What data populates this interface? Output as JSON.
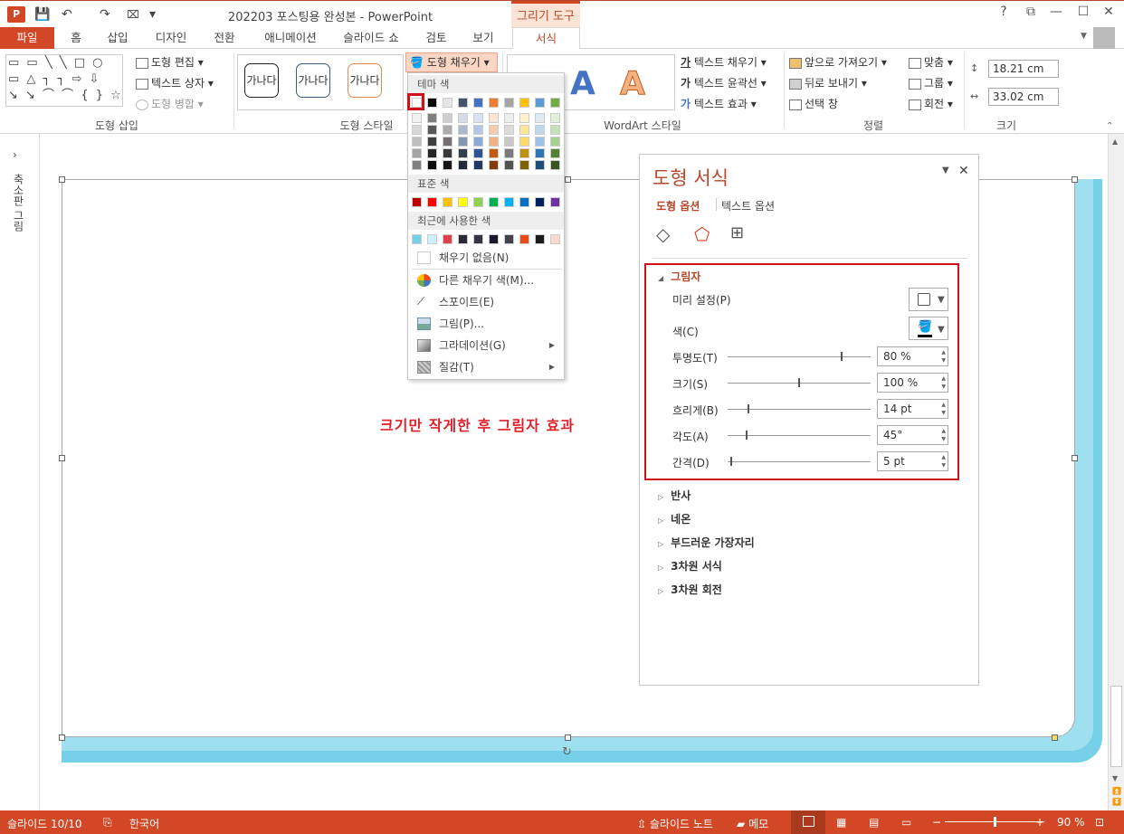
{
  "app": {
    "badge": "P",
    "title": "202203 포스팅용 완성본 - PowerPoint",
    "context_tab": "그리기 도구"
  },
  "qat": {
    "save": "💾",
    "undo": "↶",
    "redo": "↷",
    "more": "▾"
  },
  "window": {
    "help": "?",
    "restore_ribbon": "⧉",
    "minimize": "—",
    "maximize": "☐",
    "close": "✕"
  },
  "tabs": [
    "파일",
    "홈",
    "삽입",
    "디자인",
    "전환",
    "애니메이션",
    "슬라이드 쇼",
    "검토",
    "보기",
    "서식"
  ],
  "ribbon": {
    "shapes_gallery": "▭ ▭ ╲ ╲ □ ○\n▭ △ ┐ ┐ ⇨ ⇩\n↘ ↘ ⌒ ⌒ { } ☆",
    "edit_shape": "도형 편집",
    "text_box": "텍스트 상자",
    "merge_shapes": "도형 병합",
    "group_insert_shapes": "도형 삽입",
    "style_sample": "가나다",
    "fill_button": "도형 채우기",
    "group_shape_styles": "도형 스타일",
    "wordart_letter": "A",
    "text_fill": "텍스트 채우기",
    "text_outline": "텍스트 윤곽선",
    "text_effects": "텍스트 효과",
    "group_wordart": "WordArt 스타일",
    "bring_forward": "앞으로 가져오기",
    "send_backward": "뒤로 보내기",
    "selection_pane": "선택 창",
    "align": "맞춤",
    "group": "그룹",
    "rotate": "회전",
    "group_arrange": "정렬",
    "height": "18.21 cm",
    "width": "33.02 cm",
    "group_size": "크기"
  },
  "thumbnails_label": "축소판 그림",
  "slide": {
    "text": "크기만 작게한 후 그림자 효과"
  },
  "fill_dropdown": {
    "theme_colors_header": "테마 색",
    "standard_colors_header": "표준 색",
    "recent_colors_header": "최근에 사용한 색",
    "theme_top": [
      "#ffffff",
      "#000000",
      "#e7e6e6",
      "#44546a",
      "#4472c4",
      "#ed7d31",
      "#a5a5a5",
      "#ffc000",
      "#5b9bd5",
      "#70ad47"
    ],
    "theme_shades": [
      [
        "#f2f2f2",
        "#7f7f7f",
        "#d0cece",
        "#d6dce4",
        "#d9e2f3",
        "#fbe5d5",
        "#ededed",
        "#fff2cc",
        "#deebf6",
        "#e2efd9"
      ],
      [
        "#d8d8d8",
        "#595959",
        "#aeabab",
        "#adb9ca",
        "#b4c6e7",
        "#f7cbac",
        "#dbdbdb",
        "#fee599",
        "#bdd7ee",
        "#c5e0b3"
      ],
      [
        "#bfbfbf",
        "#3f3f3f",
        "#757070",
        "#8496b0",
        "#8eaadb",
        "#f4b183",
        "#c9c9c9",
        "#ffd965",
        "#9cc3e5",
        "#a8d08d"
      ],
      [
        "#a5a5a5",
        "#262626",
        "#3a3838",
        "#323f4f",
        "#2f5496",
        "#c55a11",
        "#7b7b7b",
        "#bf9000",
        "#2e75b5",
        "#538135"
      ],
      [
        "#7f7f7f",
        "#0c0c0c",
        "#171616",
        "#222a35",
        "#1f3864",
        "#833c0b",
        "#525252",
        "#7f6000",
        "#1e4e79",
        "#375623"
      ]
    ],
    "standard": [
      "#c00000",
      "#ff0000",
      "#ffc000",
      "#ffff00",
      "#92d050",
      "#00b050",
      "#00b0f0",
      "#0070c0",
      "#002060",
      "#7030a0"
    ],
    "recent": [
      "#75d0e8",
      "#cdeefa",
      "#e0404a",
      "#2a2a3a",
      "#333344",
      "#1a1a2a",
      "#404050",
      "#e84a1a",
      "#1c1c1c",
      "#f8d8d0"
    ],
    "no_fill": "채우기 없음(N)",
    "more_colors": "다른 채우기 색(M)...",
    "eyedropper": "스포이트(E)",
    "picture": "그림(P)...",
    "gradient": "그라데이션(G)",
    "texture": "질감(T)"
  },
  "format_pane": {
    "title": "도형 서식",
    "tab_shape": "도형 옵션",
    "tab_text": "텍스트 옵션",
    "shadow_section": "그림자",
    "preset_label": "미리 설정(P)",
    "color_label": "색(C)",
    "rows": [
      {
        "label": "투명도(T)",
        "value": "80 %",
        "level": 0.8
      },
      {
        "label": "크기(S)",
        "value": "100 %",
        "level": 0.5
      },
      {
        "label": "흐리게(B)",
        "value": "14 pt",
        "level": 0.14
      },
      {
        "label": "각도(A)",
        "value": "45°",
        "level": 0.125
      },
      {
        "label": "간격(D)",
        "value": "5 pt",
        "level": 0.02
      }
    ],
    "sections": [
      "반사",
      "네온",
      "부드러운 가장자리",
      "3차원 서식",
      "3차원 회전"
    ]
  },
  "status": {
    "slide_info": "슬라이드 10/10",
    "language": "한국어",
    "notes": "슬라이드 노트",
    "comments": "메모",
    "zoom": "90 %",
    "zoom_level": 0.5
  }
}
